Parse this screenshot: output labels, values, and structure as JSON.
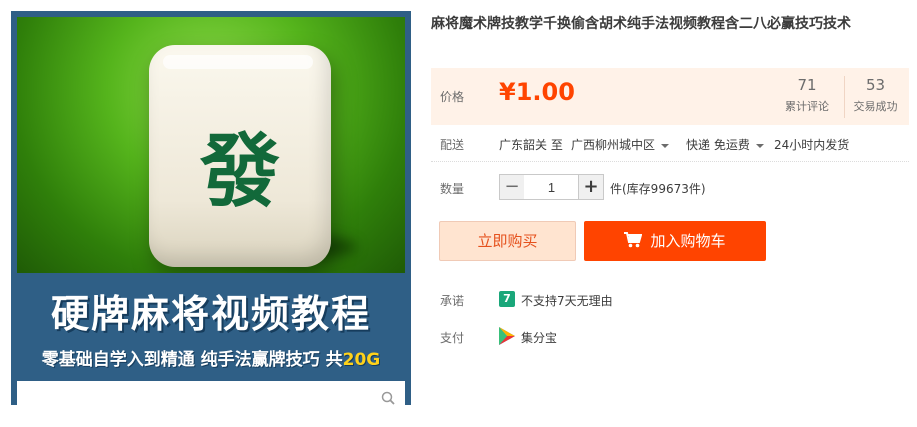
{
  "product": {
    "title": "麻将魔术牌技教学千换偷含胡术纯手法视频教程含二八必赢技巧技术"
  },
  "image": {
    "tile_glyph": "發",
    "banner_title": "硬牌麻将视频教程",
    "banner_sub_main": "零基础自学入到精通  纯手法赢牌技巧  共",
    "banner_sub_highlight": "20G"
  },
  "price": {
    "label": "价格",
    "value": "¥1.00",
    "reviews_count": "71",
    "reviews_label": "累计评论",
    "sold_count": "53",
    "sold_label": "交易成功",
    "accent_color": "#ff4400"
  },
  "shipping": {
    "label": "配送",
    "from": "广东韶关 至",
    "to": "广西柳州城中区",
    "method": "快递 免运费",
    "dispatch": "24小时内发货"
  },
  "quantity": {
    "label": "数量",
    "value": "1",
    "minus": "−",
    "plus": "+",
    "stock": "件(库存99673件)"
  },
  "actions": {
    "buy_now": "立即购买",
    "add_to_cart": "加入购物车"
  },
  "promise": {
    "label": "承诺",
    "badge": "7",
    "text": "不支持7天无理由"
  },
  "payment": {
    "label": "支付",
    "method": "集分宝"
  },
  "icons": [
    "search-icon",
    "cart-icon",
    "seven-day-icon",
    "jifenbao-icon"
  ]
}
